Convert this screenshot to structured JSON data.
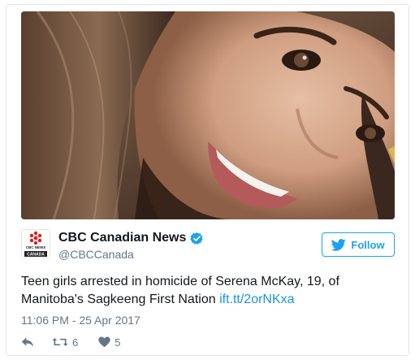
{
  "tweet": {
    "author_name": "CBC Canadian News",
    "author_handle": "@CBCCanada",
    "logo_top_text": "CBC NEWS",
    "logo_bottom_text": "CANADA",
    "follow_label": "Follow",
    "text_main": "Teen girls arrested in homicide of Serena McKay, 19, of Manitoba's Sagkeeng First Nation ",
    "link_text": "ift.tt/2orNKxa",
    "timestamp": "11:06 PM - 25 Apr 2017",
    "retweet_count": "6",
    "like_count": "5"
  },
  "icons": {
    "verified": "verified-badge-icon",
    "follow": "twitter-bird-icon",
    "reply": "reply-icon",
    "retweet": "retweet-icon",
    "like": "heart-icon"
  },
  "colors": {
    "accent": "#1da1f2",
    "link": "#1b95e0",
    "secondary_text": "#657786",
    "primary_text": "#14171a",
    "cbc_red": "#e51b1b"
  }
}
